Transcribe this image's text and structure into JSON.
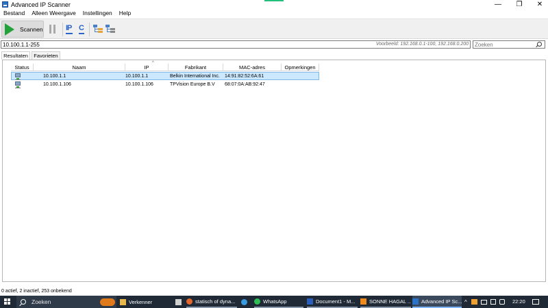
{
  "window": {
    "title": "Advanced IP Scanner",
    "controls": {
      "minimize": "—",
      "maximize": "❐",
      "close": "✕"
    }
  },
  "menu": [
    "Bestand",
    "Alleen Weergave",
    "Instellingen",
    "Help"
  ],
  "toolbar": {
    "scan_label": "Scannen",
    "ip_label": "IP",
    "c_label": "C"
  },
  "address": {
    "range_value": "10.100.1.1-255",
    "example_text": "Voorbeeld: 192.168.0.1-100, 192.168.0.200",
    "search_placeholder": "Zoeken"
  },
  "tabs": [
    "Resultaten",
    "Favorieten"
  ],
  "table": {
    "columns": [
      "Status",
      "Naam",
      "IP",
      "Fabrikant",
      "MAC-adres",
      "Opmerkingen"
    ],
    "sort_indicator": "^",
    "rows": [
      {
        "naam": "10.100.1.1",
        "ip": "10.100.1.1",
        "fabrikant": "Belkin International Inc.",
        "mac": "14:91:82:52:6A:61",
        "opmerkingen": ""
      },
      {
        "naam": "10.100.1.106",
        "ip": "10.100.1.106",
        "fabrikant": "TPVision Europe B.V",
        "mac": "68:07:0A:AB:92:47",
        "opmerkingen": ""
      }
    ]
  },
  "status_bar": "0 actief, 2 inactief, 253 onbekend",
  "taskbar": {
    "search_placeholder": "Zoeken",
    "tasks": [
      {
        "label": "Verkenner",
        "icon": "folder-icon",
        "color": "#e8b84a"
      },
      {
        "label": "",
        "icon": "file-icon",
        "color": "#d0d0d0"
      },
      {
        "label": "statisch of dyna...",
        "icon": "firefox-icon",
        "color": "#e5662c"
      },
      {
        "label": "",
        "icon": "telegram-icon",
        "color": "#3b9be0"
      },
      {
        "label": "WhatsApp",
        "icon": "whatsapp-icon",
        "color": "#2fbd55"
      },
      {
        "label": "Document1 - M...",
        "icon": "word-icon",
        "color": "#2b5eb8"
      },
      {
        "label": "SONNE HAGAL ...",
        "icon": "vlc-icon",
        "color": "#f08a1c"
      },
      {
        "label": "Advanced IP Sc...",
        "icon": "ip-scanner-icon",
        "color": "#2a73c9"
      }
    ],
    "time": "22:20"
  }
}
